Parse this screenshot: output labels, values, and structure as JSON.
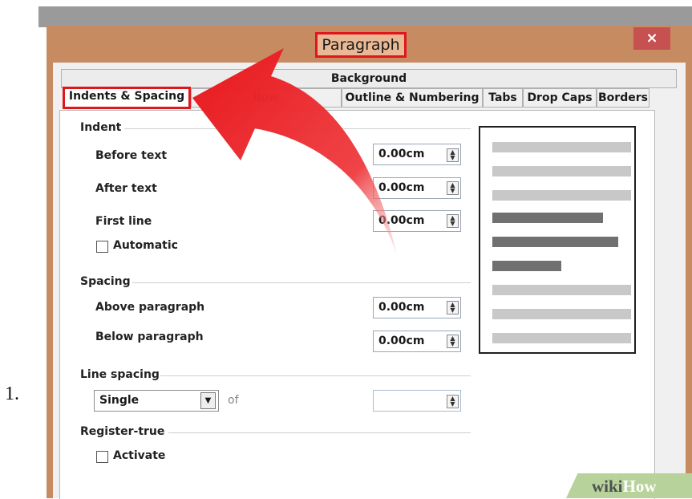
{
  "step_number": "1.",
  "dialog": {
    "title": "Paragraph",
    "close_glyph": "×"
  },
  "tabs": {
    "row1": [
      {
        "label": "Background"
      }
    ],
    "row2": [
      {
        "label": "Indents & Spacing"
      },
      {
        "label": "llow"
      },
      {
        "label": "Outline & Numbering"
      },
      {
        "label": "Tabs"
      },
      {
        "label": "Drop Caps"
      },
      {
        "label": "Borders"
      }
    ]
  },
  "indent": {
    "heading": "Indent",
    "before_text": {
      "label": "Before text",
      "value": "0.00cm"
    },
    "after_text": {
      "label": "After text",
      "value": "0.00cm"
    },
    "first_line": {
      "label": "First line",
      "value": "0.00cm"
    },
    "automatic": {
      "label": "Automatic",
      "checked": false
    }
  },
  "spacing": {
    "heading": "Spacing",
    "above": {
      "label": "Above paragraph",
      "value": "0.00cm"
    },
    "below": {
      "label": "Below paragraph",
      "value": "0.00cm"
    }
  },
  "line_spacing": {
    "heading": "Line spacing",
    "selected": "Single",
    "of_label": "of",
    "of_value": ""
  },
  "register_true": {
    "heading": "Register-true",
    "activate": {
      "label": "Activate",
      "checked": false
    }
  },
  "watermark": {
    "part1": "wiki",
    "part2": "How"
  },
  "colors": {
    "highlight": "#e0161c",
    "arrow": "#e8171c",
    "window_frame": "#c78b62",
    "preview_light": "#c8c8c8",
    "preview_dark": "#707070"
  },
  "icons": {
    "arrow": "curved-red-arrow",
    "spinner": "spin-up-down-icon",
    "dropdown": "chevron-down-icon"
  }
}
